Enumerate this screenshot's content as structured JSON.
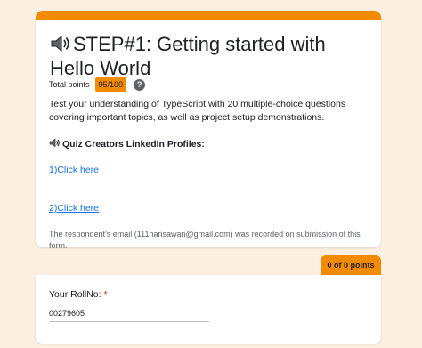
{
  "form": {
    "title": "STEP#1: Getting started with Hello World",
    "total_points_label": "Total points",
    "total_points_value": "95/100",
    "help_symbol": "?",
    "description": "Test your understanding of TypeScript with 20 multiple-choice questions covering important topics, as well as project setup demonstrations.",
    "creators_label": "Quiz Creators LinkedIn Profiles:",
    "links": [
      "1)Click here",
      "2)Click here"
    ],
    "email_note": "The respondent's email (111harisawan@gmail.com) was recorded on submission of this form."
  },
  "question": {
    "score": "0 of 0 points",
    "label": "Your RollNo:",
    "required_mark": "*",
    "answer": "00279605"
  },
  "colors": {
    "accent": "#f28b00",
    "background": "#fcefe2",
    "link": "#1a73e8",
    "required": "#d93025"
  },
  "icons": [
    "speaker-icon",
    "help-icon"
  ]
}
